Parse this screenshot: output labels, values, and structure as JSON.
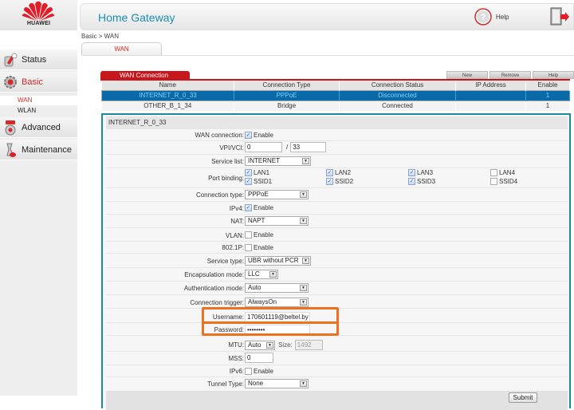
{
  "brand": {
    "name": "HUAWEI",
    "accent": "#c8161d",
    "title_color": "#1b8fb3"
  },
  "header": {
    "title": "Home Gateway",
    "help_label": "Help"
  },
  "breadcrumb": "Basic > WAN",
  "page_tab": "WAN",
  "sidebar": {
    "items": [
      {
        "label": "Status",
        "icon": "status-icon",
        "active": false
      },
      {
        "label": "Basic",
        "icon": "gear-icon",
        "active": true
      },
      {
        "label": "Advanced",
        "icon": "advanced-icon",
        "active": false
      },
      {
        "label": "Maintenance",
        "icon": "maintenance-icon",
        "active": false
      }
    ],
    "subitems": [
      {
        "label": "WAN",
        "active": true
      },
      {
        "label": "WLAN",
        "active": false
      }
    ]
  },
  "wan_table": {
    "tab_label": "WAN Connection",
    "buttons": {
      "new": "New",
      "remove": "Remove",
      "help": "Help"
    },
    "columns": [
      "Name",
      "Connection Type",
      "Connection Status",
      "IP Address",
      "Enable"
    ],
    "rows": [
      {
        "name": "INTERNET_R_0_33",
        "type": "PPPoE",
        "status": "Disconnected",
        "ip": "",
        "enable": "1",
        "selected": true
      },
      {
        "name": "OTHER_B_1_34",
        "type": "Bridge",
        "status": "Connected",
        "ip": "",
        "enable": "1",
        "selected": false
      }
    ]
  },
  "detail": {
    "title": "INTERNET_R_0_33",
    "wan_connection": {
      "label": "WAN connection:",
      "option": "Enable",
      "checked": true
    },
    "vpi_vci": {
      "label": "VPI/VCI:",
      "vpi": "0",
      "separator": "/",
      "vci": "33"
    },
    "service_list": {
      "label": "Service list:",
      "value": "INTERNET"
    },
    "port_binding": {
      "label": "Port binding:",
      "ports": [
        {
          "label": "LAN1",
          "checked": true
        },
        {
          "label": "LAN2",
          "checked": true
        },
        {
          "label": "LAN3",
          "checked": true
        },
        {
          "label": "LAN4",
          "checked": false
        },
        {
          "label": "SSID1",
          "checked": true
        },
        {
          "label": "SSID2",
          "checked": true
        },
        {
          "label": "SSID3",
          "checked": true
        },
        {
          "label": "SSID4",
          "checked": false
        }
      ]
    },
    "connection_type": {
      "label": "Connection type:",
      "value": "PPPoE"
    },
    "ipv4": {
      "label": "IPv4:",
      "option": "Enable",
      "checked": true
    },
    "nat": {
      "label": "NAT:",
      "value": "NAPT"
    },
    "vlan": {
      "label": "VLAN:",
      "option": "Enable",
      "checked": false
    },
    "p8021": {
      "label": "802.1P:",
      "option": "Enable",
      "checked": false
    },
    "service_type": {
      "label": "Service type:",
      "value": "UBR without PCR"
    },
    "encapsulation": {
      "label": "Encapsulation mode:",
      "value": "LLC"
    },
    "auth_mode": {
      "label": "Authentication mode:",
      "value": "Auto"
    },
    "conn_trigger": {
      "label": "Connection trigger:",
      "value": "AlwaysOn"
    },
    "username": {
      "label": "Username:",
      "value": "170601119@beltel.by"
    },
    "password": {
      "label": "Password:",
      "value": "••••••••"
    },
    "mtu": {
      "label": "MTU:",
      "value": "Auto",
      "size_label": "Size:",
      "size_value": "1492"
    },
    "mss": {
      "label": "MSS:",
      "value": "0"
    },
    "ipv6": {
      "label": "IPv6:",
      "option": "Enable",
      "checked": false
    },
    "tunnel_type": {
      "label": "Tunnel Type:",
      "value": "None"
    },
    "submit_label": "Submit"
  },
  "highlight_color": "#f07020"
}
